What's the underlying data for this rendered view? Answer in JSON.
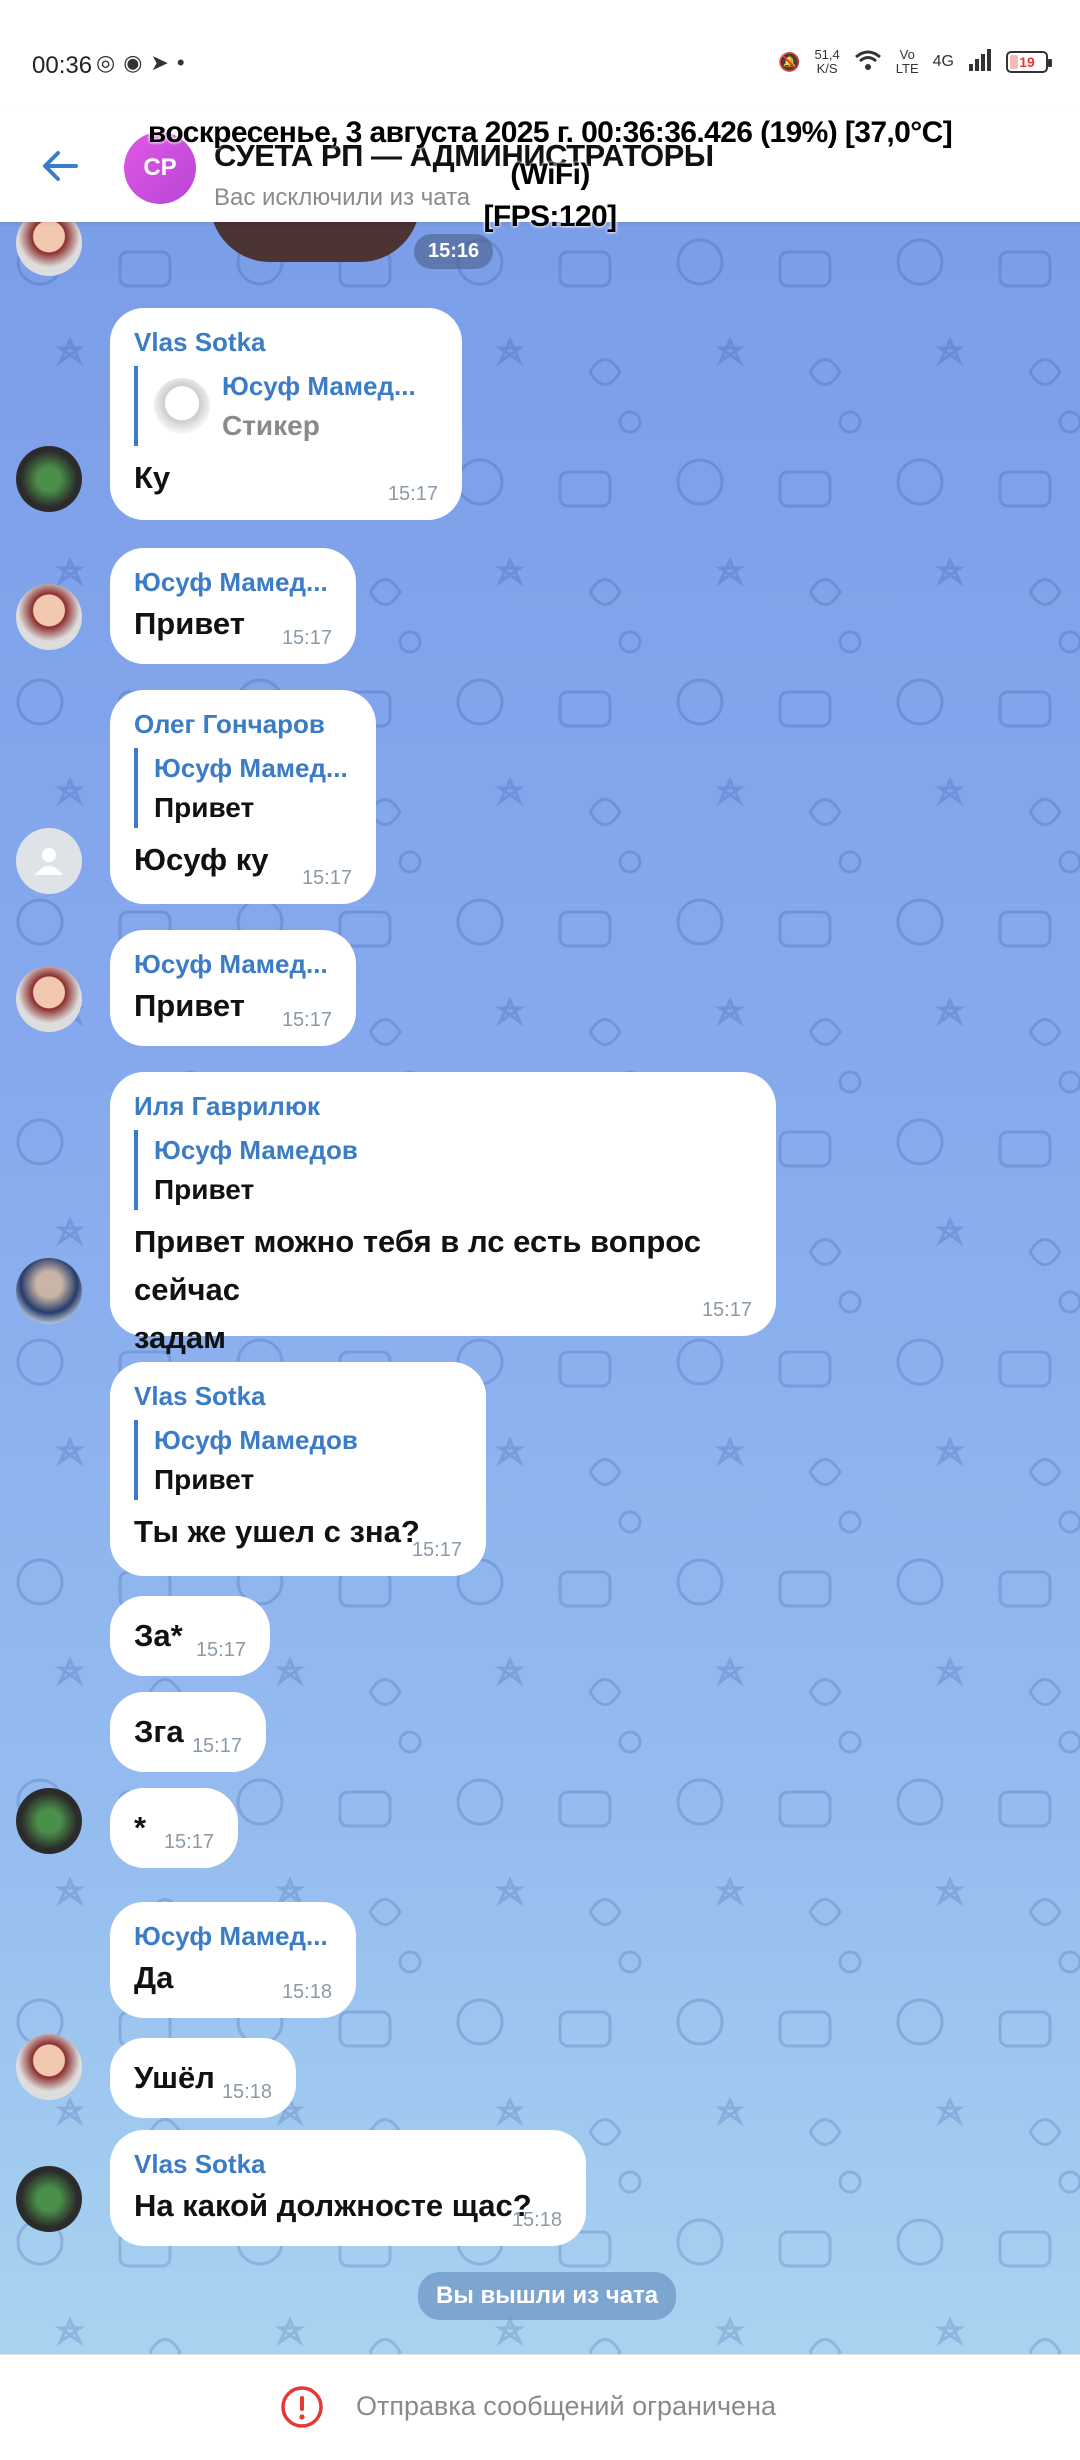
{
  "status_bar": {
    "time": "00:36",
    "net_speed": "51,4\nK/S",
    "volte": "Vo\nLTE",
    "network": "4G",
    "battery": "19"
  },
  "overlay": {
    "line1": "воскресенье, 3 августа 2025 г. 00:36:36.426 (19%) [37,0°C] (WiFi)",
    "line2": "[FPS:120]"
  },
  "header": {
    "avatar_initials": "СР",
    "title": "СУЕТА РП — АДМИНИСТРАТОРЫ",
    "subtitle": "Вас исключили из чата"
  },
  "sticker_time": "15:16",
  "messages": [
    {
      "sender": "Vlas Sotka",
      "reply_name": "Юсуф Мамед...",
      "reply_text": "Стикер",
      "text": "Ку",
      "time": "15:17"
    },
    {
      "sender": "Юсуф Мамед...",
      "text": "Привет",
      "time": "15:17"
    },
    {
      "sender": "Олег Гончаров",
      "reply_name": "Юсуф Мамед...",
      "reply_text": "Привет",
      "text": "Юсуф ку",
      "time": "15:17"
    },
    {
      "sender": "Юсуф Мамед...",
      "text": "Привет",
      "time": "15:17"
    },
    {
      "sender": "Иля Гаврилюк",
      "reply_name": "Юсуф Мамедов",
      "reply_text": "Привет",
      "text_line1": "Привет можно тебя в лс есть вопрос сейчас",
      "text_line2": "задам",
      "time": "15:17"
    },
    {
      "sender": "Vlas Sotka",
      "reply_name": "Юсуф Мамедов",
      "reply_text": "Привет",
      "text": "Ты же ушел с зна?",
      "time": "15:17"
    },
    {
      "text": "За*",
      "time": "15:17"
    },
    {
      "text": "Зга",
      "time": "15:17"
    },
    {
      "text": "*",
      "time": "15:17"
    },
    {
      "sender": "Юсуф Мамед...",
      "text": "Да",
      "time": "15:18"
    },
    {
      "text": "Ушёл",
      "time": "15:18"
    },
    {
      "sender": "Vlas Sotka",
      "text": "На какой должносте щас?",
      "time": "15:18"
    }
  ],
  "service_message": "Вы вышли из чата",
  "bottom_bar": {
    "restricted_text": "Отправка сообщений ограничена"
  },
  "colors": {
    "accent": "#3b7cc7",
    "warning": "#e53935",
    "avatar_gradient": "#d456e4"
  }
}
